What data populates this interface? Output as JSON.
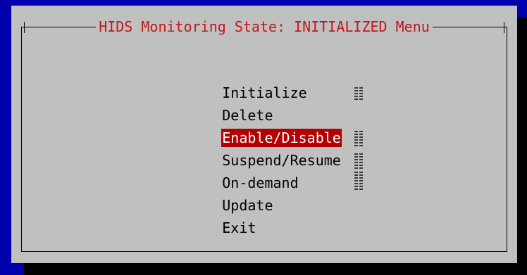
{
  "dialog": {
    "title": "HIDS Monitoring State: INITIALIZED Menu"
  },
  "menu": {
    "items": [
      {
        "label": "Initialize",
        "selected": false
      },
      {
        "label": "Delete",
        "selected": false
      },
      {
        "label": "Enable/Disable",
        "selected": true
      },
      {
        "label": "Suspend/Resume",
        "selected": false
      },
      {
        "label": "On-demand",
        "selected": false
      },
      {
        "label": "Update",
        "selected": false
      },
      {
        "label": "Exit",
        "selected": false
      }
    ]
  },
  "colors": {
    "background": "#0000ac",
    "dialog": "#c0c0c0",
    "title_text": "#c21818",
    "selected_bg": "#b30000",
    "selected_text": "#ffffff"
  },
  "scrollbar": {
    "icon": "scrollbar-hatch-icon"
  }
}
